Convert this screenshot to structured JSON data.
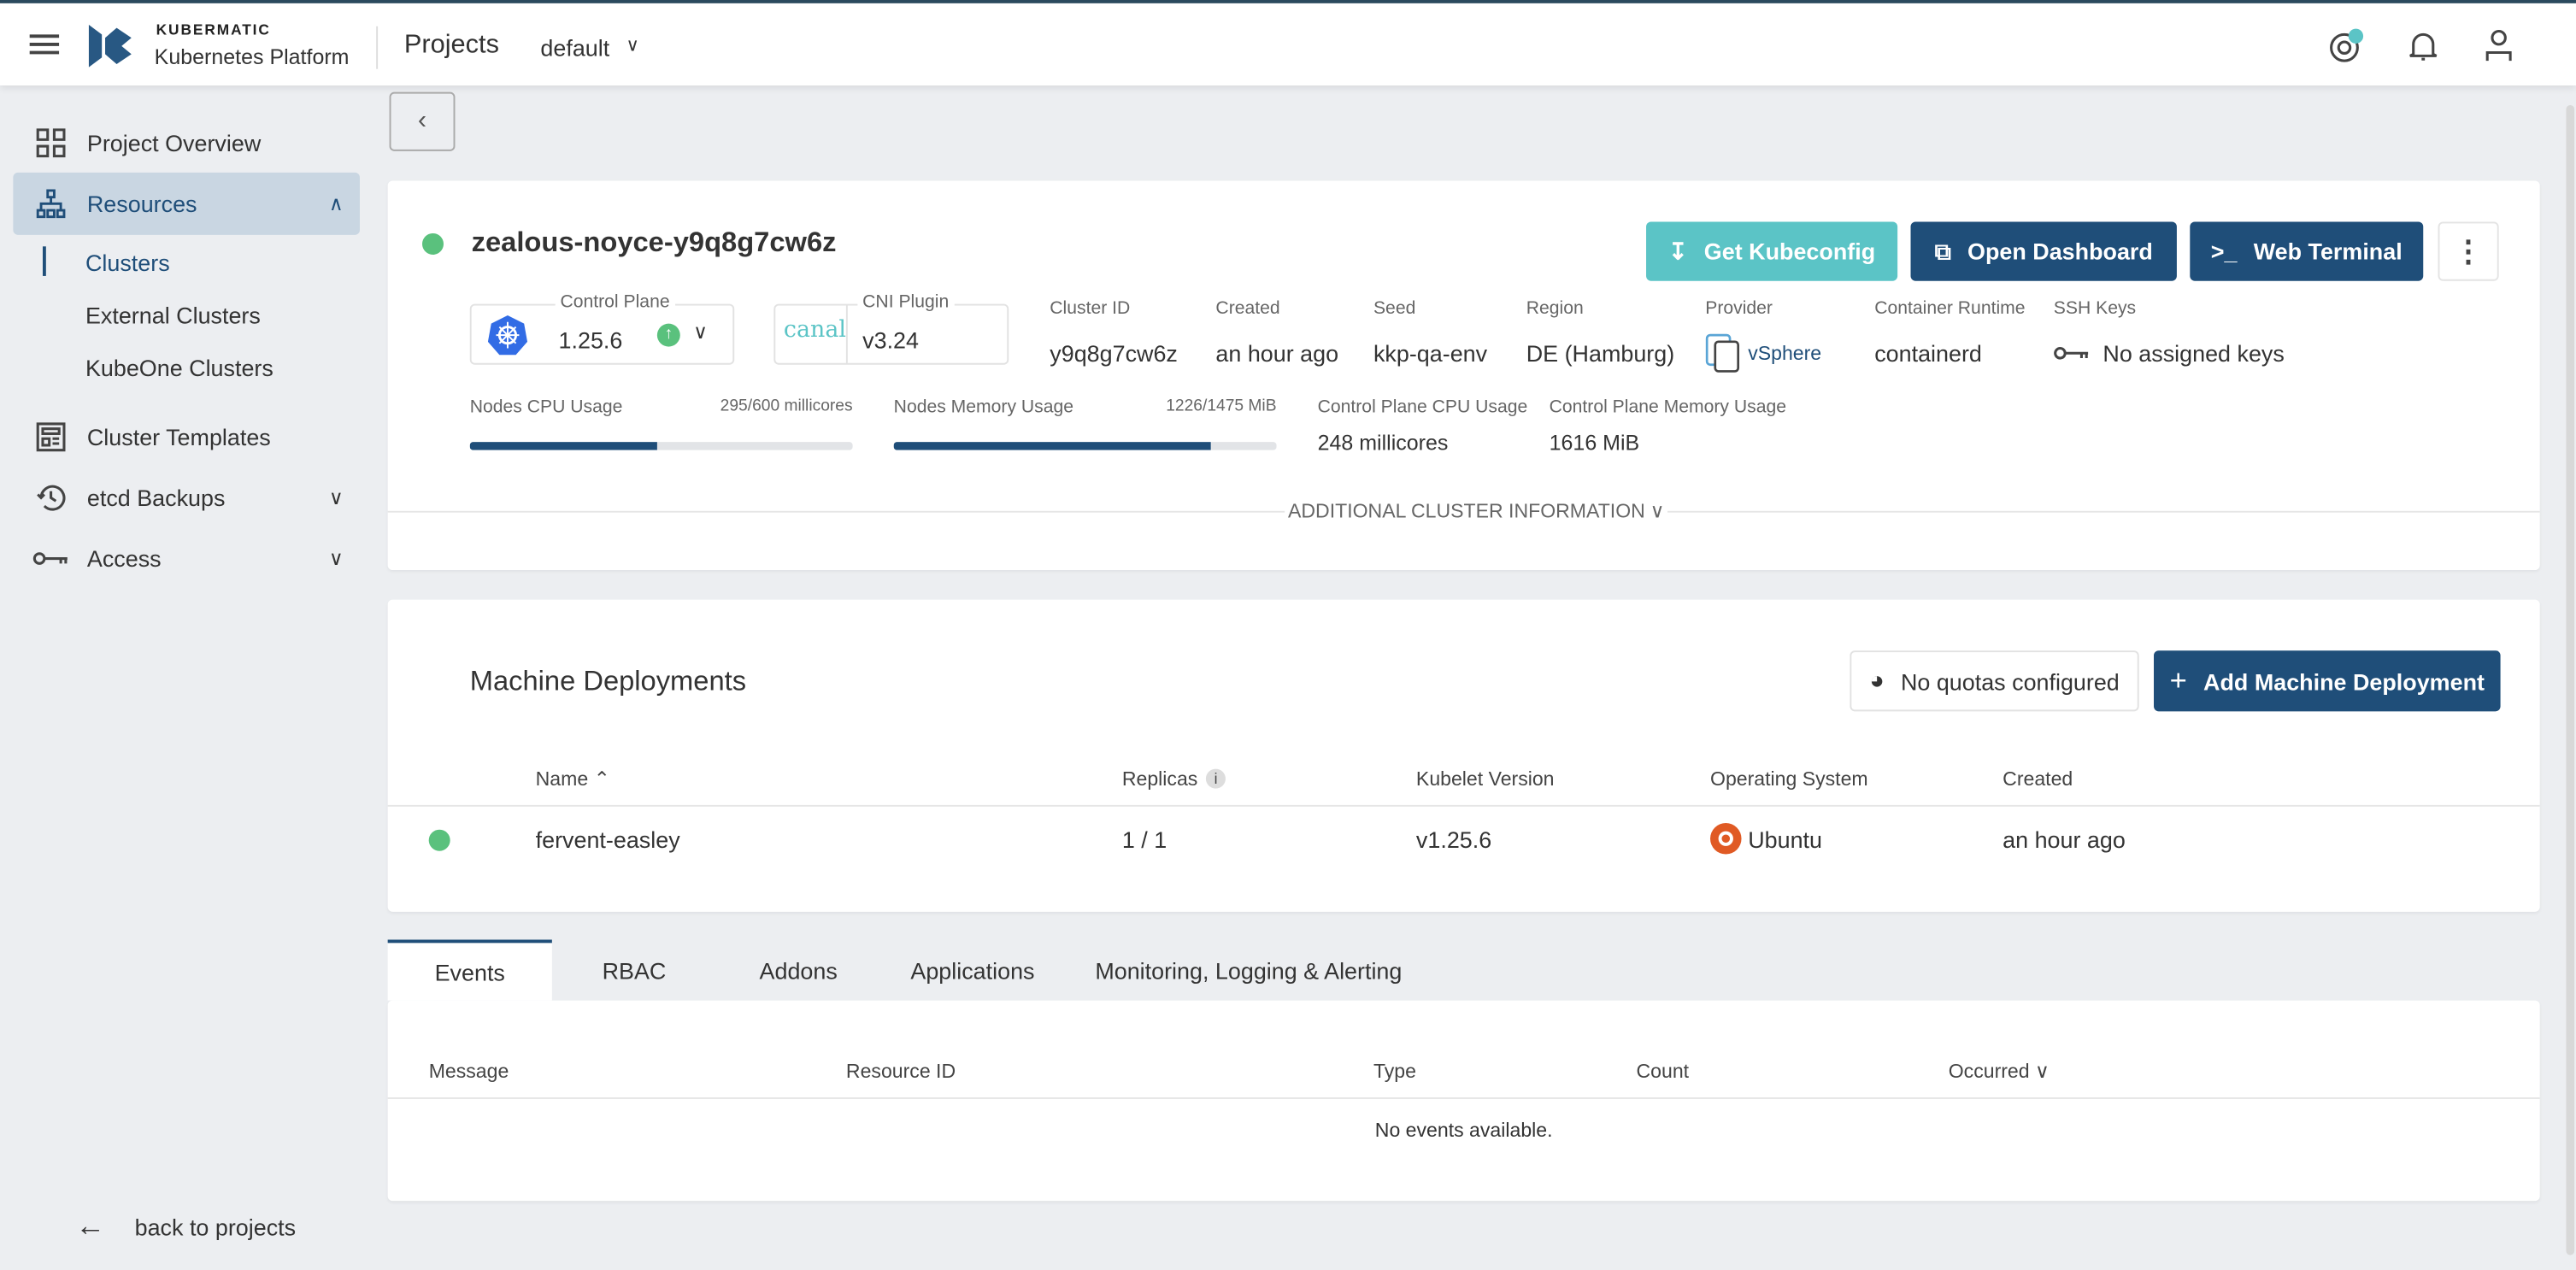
{
  "header": {
    "brand_top": "KUBERMATIC",
    "brand_bottom": "Kubernetes Platform",
    "section": "Projects",
    "project": "default"
  },
  "sidebar": {
    "items": [
      {
        "label": "Project Overview"
      },
      {
        "label": "Resources"
      },
      {
        "label": "Cluster Templates"
      },
      {
        "label": "etcd Backups"
      },
      {
        "label": "Access"
      }
    ],
    "sub_items": [
      {
        "label": "Clusters"
      },
      {
        "label": "External Clusters"
      },
      {
        "label": "KubeOne Clusters"
      }
    ],
    "back": "back to projects"
  },
  "cluster": {
    "name": "zealous-noyce-y9q8g7cw6z",
    "status_color": "#5ac17d",
    "buttons": {
      "kubeconfig": "Get Kubeconfig",
      "dashboard": "Open Dashboard",
      "terminal": "Web Terminal"
    },
    "control_plane": {
      "label": "Control Plane",
      "version": "1.25.6"
    },
    "cni": {
      "label": "CNI Plugin",
      "logo": "canal",
      "version": "v3.24"
    },
    "info": [
      {
        "label": "Cluster ID",
        "value": "y9q8g7cw6z"
      },
      {
        "label": "Created",
        "value": "an hour ago"
      },
      {
        "label": "Seed",
        "value": "kkp-qa-env"
      },
      {
        "label": "Region",
        "value": "DE (Hamburg)"
      },
      {
        "label": "Provider",
        "value": "vSphere"
      },
      {
        "label": "Container Runtime",
        "value": "containerd"
      },
      {
        "label": "SSH Keys",
        "value": "No assigned keys"
      }
    ],
    "usage": {
      "cpu_label": "Nodes CPU Usage",
      "cpu_value": "295/600 millicores",
      "cpu_fraction": 0.49,
      "mem_label": "Nodes Memory Usage",
      "mem_value": "1226/1475 MiB",
      "mem_fraction": 0.83,
      "cp_cpu_label": "Control Plane CPU Usage",
      "cp_cpu_value": "248 millicores",
      "cp_mem_label": "Control Plane Memory Usage",
      "cp_mem_value": "1616 MiB"
    },
    "additional": "ADDITIONAL CLUSTER INFORMATION"
  },
  "md": {
    "title": "Machine Deployments",
    "quota": "No quotas configured",
    "add": "Add Machine Deployment",
    "columns": [
      "Name",
      "Replicas",
      "Kubelet Version",
      "Operating System",
      "Created"
    ],
    "rows": [
      {
        "name": "fervent-easley",
        "replicas": "1 / 1",
        "kubelet": "v1.25.6",
        "os": "Ubuntu",
        "created": "an hour ago"
      }
    ]
  },
  "tabs": [
    "Events",
    "RBAC",
    "Addons",
    "Applications",
    "Monitoring, Logging & Alerting"
  ],
  "events": {
    "columns": [
      "Message",
      "Resource ID",
      "Type",
      "Count",
      "Occurred"
    ],
    "empty": "No events available."
  },
  "colors": {
    "primary": "#1f4e79",
    "accent": "#5bc4c6",
    "active_nav": "#c9d6e2"
  }
}
